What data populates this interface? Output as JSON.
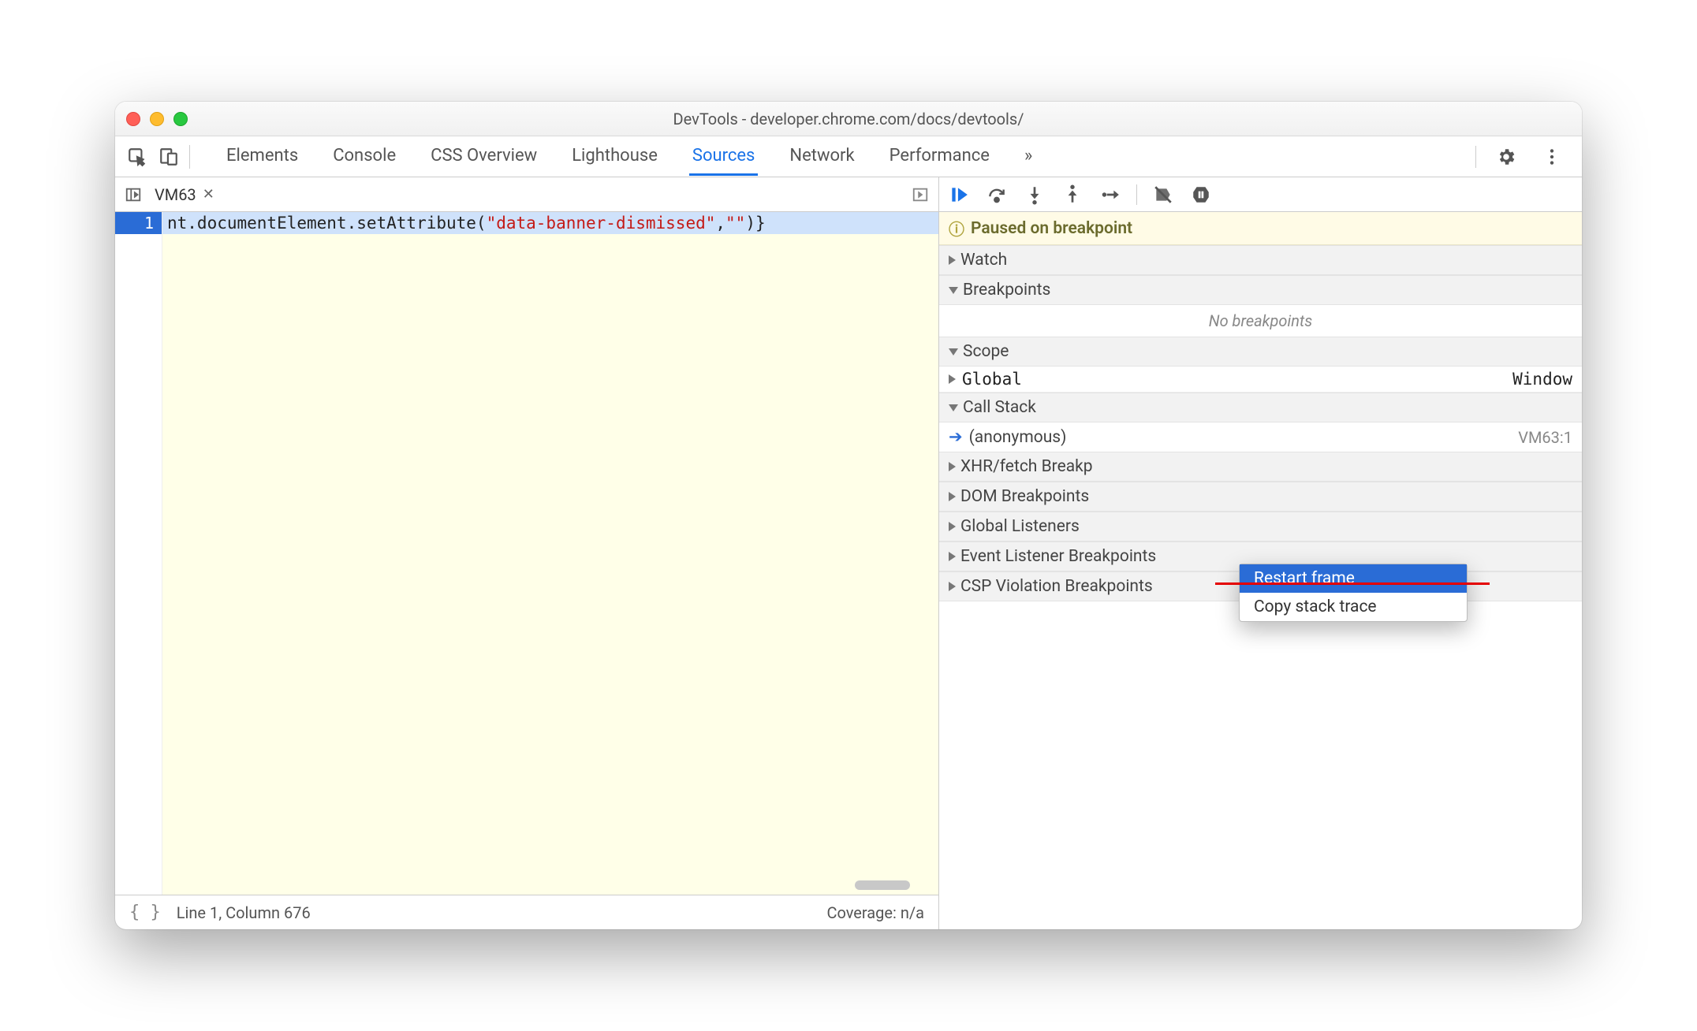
{
  "titlebar": {
    "title": "DevTools - developer.chrome.com/docs/devtools/"
  },
  "tabs": {
    "items": [
      "Elements",
      "Console",
      "CSS Overview",
      "Lighthouse",
      "Sources",
      "Network",
      "Performance"
    ],
    "activeIndex": 4,
    "overflow": "»"
  },
  "openFile": {
    "name": "VM63"
  },
  "code": {
    "lineNumber": "1",
    "seg1": "nt.documentElement.setAttribute(",
    "str1": "\"data-banner-dismissed\"",
    "seg2": ",",
    "str2": "\"\"",
    "seg3": ")}"
  },
  "status": {
    "formatLabel": "{ }",
    "position": "Line 1, Column 676",
    "coverage": "Coverage: n/a"
  },
  "debugger": {
    "paused": "Paused on breakpoint",
    "sections": {
      "watch": "Watch",
      "breakpoints": "Breakpoints",
      "noBreakpoints": "No breakpoints",
      "scope": "Scope",
      "scopeGlobal": "Global",
      "scopeGlobalVal": "Window",
      "callStack": "Call Stack",
      "anonymous": "(anonymous)",
      "anonymousLoc": "VM63:1",
      "xhr": "XHR/fetch Breakp",
      "dom": "DOM Breakpoints",
      "globalListeners": "Global Listeners",
      "eventListeners": "Event Listener Breakpoints",
      "csp": "CSP Violation Breakpoints"
    }
  },
  "contextMenu": {
    "restartFrame": "Restart frame",
    "copyStack": "Copy stack trace"
  }
}
